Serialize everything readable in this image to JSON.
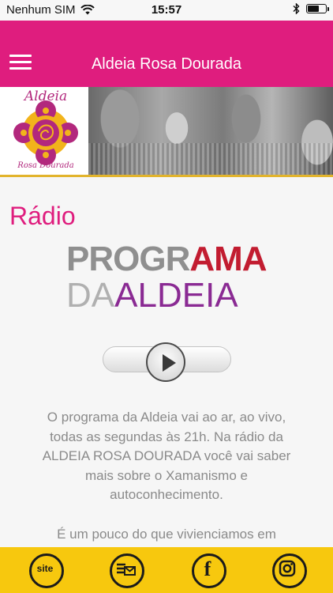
{
  "status_bar": {
    "carrier": "Nenhum SIM",
    "time": "15:57"
  },
  "header": {
    "title": "Aldeia Rosa Dourada"
  },
  "banner": {
    "logo_top": "Aldeia",
    "logo_bottom": "Rosa Dourada"
  },
  "main": {
    "title": "Rádio",
    "program_logo": {
      "line1_a": "PROGR",
      "line1_b": "AMA",
      "line2_a": "DA",
      "line2_b": "ALDEIA"
    },
    "description": "O programa da Aldeia vai ao ar, ao vivo, todas as segundas às 21h. Na rádio da ALDEIA ROSA DOURADA você vai saber mais sobre o Xamanismo e autoconhecimento.",
    "description_more": "É um pouco do que vivienciamos em"
  },
  "bottom_nav": {
    "site_label": "site",
    "facebook_label": "f",
    "icons": [
      "site-icon",
      "newsletter-icon",
      "facebook-icon",
      "instagram-icon"
    ]
  },
  "colors": {
    "primary": "#df1d7e",
    "accent": "#f7c80e",
    "gold_line": "#e2b42c"
  }
}
